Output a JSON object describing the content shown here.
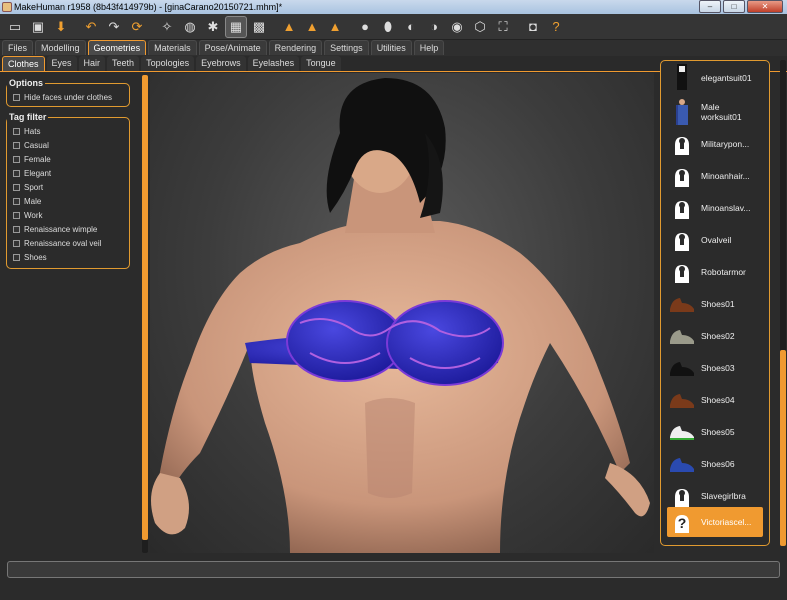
{
  "window": {
    "title": "MakeHuman r1958 (8b43f414979b) - [ginaCarano20150721.mhm]*",
    "min_label": "–",
    "max_label": "□",
    "close_label": "✕"
  },
  "toolbar": {
    "icons": [
      "window-icon",
      "save-icon",
      "export-icon",
      "undo-icon",
      "redo-icon",
      "reset-icon",
      "smooth-icon",
      "wireframe-icon",
      "pose-icon",
      "grid-icon",
      "background-icon",
      "front-view-icon",
      "back-view-icon",
      "left-view-icon",
      "right-view-icon",
      "top-view-icon",
      "bottom-view-icon",
      "reset-camera-icon",
      "screenshot-icon",
      "help-icon"
    ]
  },
  "menu": [
    "Files",
    "Modelling",
    "Geometries",
    "Materials",
    "Pose/Animate",
    "Rendering",
    "Settings",
    "Utilities",
    "Help"
  ],
  "subtabs": [
    "Clothes",
    "Eyes",
    "Hair",
    "Teeth",
    "Topologies",
    "Eyebrows",
    "Eyelashes",
    "Tongue"
  ],
  "options": {
    "title": "Options",
    "hide_faces": "Hide faces under clothes"
  },
  "tag_filter": {
    "title": "Tag filter",
    "tags": [
      "Hats",
      "Casual",
      "Female",
      "Elegant",
      "Sport",
      "Male",
      "Work",
      "Renaissance wimple",
      "Renaissance oval veil",
      "Shoes"
    ]
  },
  "clothes_list": [
    {
      "name": "elegantsuit01",
      "thumb": "suit-thumb-icon"
    },
    {
      "name": "Male\nworksuit01",
      "thumb": "worksuit-thumb-icon"
    },
    {
      "name": "Militarypon...",
      "thumb": "notfound-thumb-icon"
    },
    {
      "name": "Minoanhair...",
      "thumb": "notfound-thumb-icon"
    },
    {
      "name": "Minoanslav...",
      "thumb": "notfound-thumb-icon"
    },
    {
      "name": "Ovalveil",
      "thumb": "notfound-thumb-icon"
    },
    {
      "name": "Robotarmor",
      "thumb": "notfound-thumb-icon"
    },
    {
      "name": "Shoes01",
      "thumb": "brown-shoe-icon"
    },
    {
      "name": "Shoes02",
      "thumb": "grey-shoe-icon"
    },
    {
      "name": "Shoes03",
      "thumb": "black-shoe-icon"
    },
    {
      "name": "Shoes04",
      "thumb": "brown-shoe-icon"
    },
    {
      "name": "Shoes05",
      "thumb": "white-shoe-icon"
    },
    {
      "name": "Shoes06",
      "thumb": "blue-shoe-icon"
    },
    {
      "name": "Slavegirlbra",
      "thumb": "notfound-thumb-icon"
    },
    {
      "name": "Victoriascel...",
      "thumb": "question-thumb-icon",
      "selected": true
    }
  ],
  "colors": {
    "accent": "#f09a30",
    "bra": "#2a2ab8",
    "skin": "#d8a88a",
    "hair": "#111111"
  },
  "status": ""
}
